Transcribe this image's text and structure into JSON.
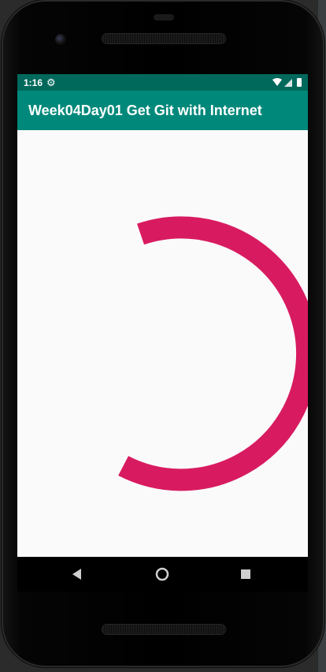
{
  "status_bar": {
    "time": "1:16",
    "icons": [
      "gear-icon",
      "wifi-icon",
      "signal-icon",
      "battery-icon"
    ]
  },
  "app_bar": {
    "title": "Week04Day01 Get Git with Internet",
    "color": "#00897b",
    "status_color": "#00695c"
  },
  "progress": {
    "type": "circular-indeterminate",
    "color": "#d81b60"
  },
  "nav_bar": {
    "buttons": [
      "back-icon",
      "home-icon",
      "recents-icon"
    ]
  }
}
